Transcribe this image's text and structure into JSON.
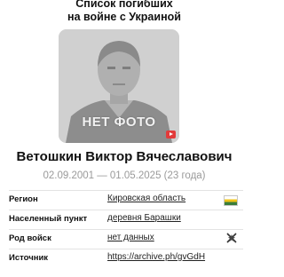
{
  "header": {
    "title_line1": "Список погибших",
    "title_line2": "на войне с Украиной"
  },
  "photo": {
    "placeholder_text": "НЕТ ФОТО",
    "badge_color": "#e23b3b"
  },
  "person": {
    "name": "Ветошкин Виктор Вячеславович",
    "dates": "02.09.2001 — 01.05.2025 (23 года)"
  },
  "details": [
    {
      "label": "Регион",
      "value": "Кировская область",
      "icon": "region-flag-icon"
    },
    {
      "label": "Населенный пункт",
      "value": "деревня Барашки",
      "icon": ""
    },
    {
      "label": "Род войск",
      "value": "нет данных",
      "icon": "military-emblem-icon"
    },
    {
      "label": "Источник",
      "value": "https://archive.ph/gvGdH",
      "icon": ""
    }
  ]
}
